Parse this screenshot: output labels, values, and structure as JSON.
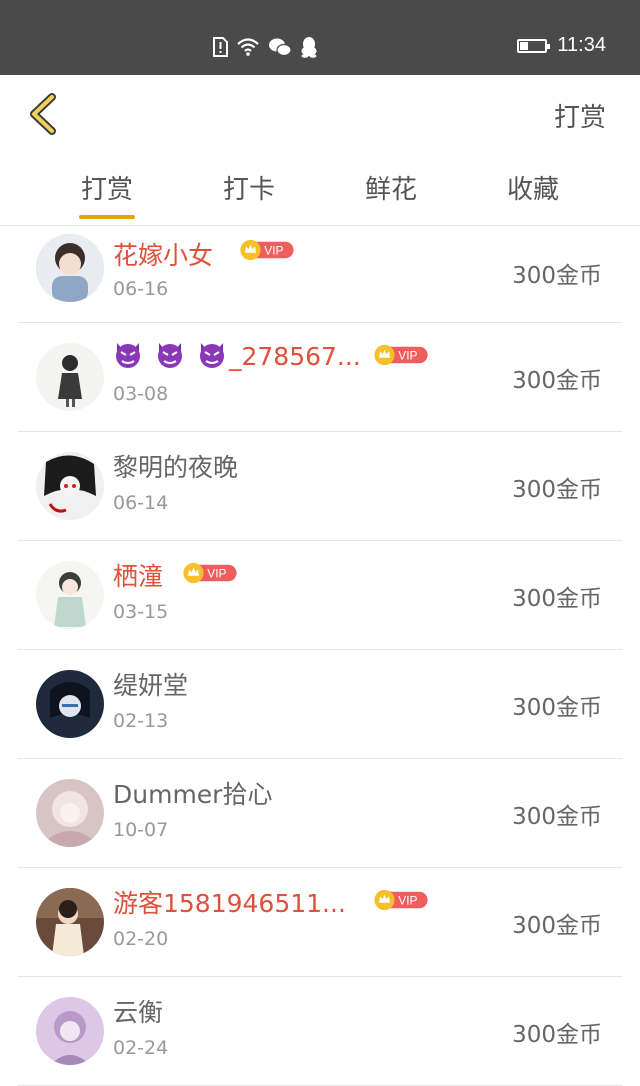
{
  "status_bar": {
    "time": "11:34",
    "battery_level": 0.35
  },
  "header": {
    "title": "打赏"
  },
  "tabs": [
    {
      "label": "打赏",
      "active": true
    },
    {
      "label": "打卡",
      "active": false
    },
    {
      "label": "鲜花",
      "active": false
    },
    {
      "label": "收藏",
      "active": false
    }
  ],
  "vip_label": "VIP",
  "colors": {
    "accent": "#e8a019",
    "vip_name": "#e0503a",
    "vip_badge": "#ef5d5d",
    "crown": "#f5c02a"
  },
  "rows": [
    {
      "name": "花嫁小女",
      "date": "06-16",
      "amount": "300金币",
      "vip": true
    },
    {
      "name_prefix_icons": [
        "devil-emoji",
        "devil-emoji",
        "devil-emoji"
      ],
      "name": "_278567...",
      "date": "03-08",
      "amount": "300金币",
      "vip": true
    },
    {
      "name": "黎明的夜晚",
      "date": "06-14",
      "amount": "300金币",
      "vip": false
    },
    {
      "name": "栖潼",
      "date": "03-15",
      "amount": "300金币",
      "vip": true
    },
    {
      "name": "缇妍堂",
      "date": "02-13",
      "amount": "300金币",
      "vip": false
    },
    {
      "name": "Dummer拾心",
      "date": "10-07",
      "amount": "300金币",
      "vip": false
    },
    {
      "name": "游客1581946511...",
      "date": "02-20",
      "amount": "300金币",
      "vip": true
    },
    {
      "name": "云衡",
      "date": "02-24",
      "amount": "300金币",
      "vip": false
    }
  ]
}
